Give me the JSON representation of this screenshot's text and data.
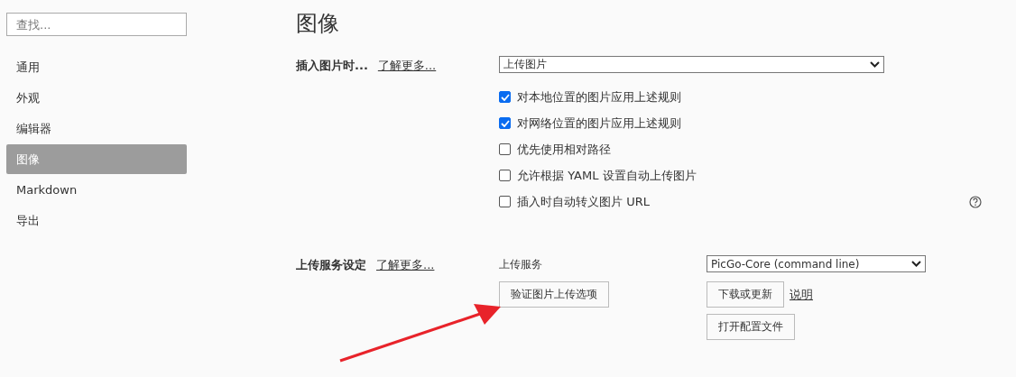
{
  "sidebar": {
    "search": {
      "placeholder": "查找..."
    },
    "items": [
      {
        "label": "通用",
        "selected": false
      },
      {
        "label": "外观",
        "selected": false
      },
      {
        "label": "编辑器",
        "selected": false
      },
      {
        "label": "图像",
        "selected": true
      },
      {
        "label": "Markdown",
        "selected": false
      },
      {
        "label": "导出",
        "selected": false
      }
    ]
  },
  "page_title": "图像",
  "insert_section": {
    "label": "插入图片时...",
    "link": "了解更多...",
    "select_value": "上传图片",
    "options": [
      {
        "label": "对本地位置的图片应用上述规则",
        "checked": true
      },
      {
        "label": "对网络位置的图片应用上述规则",
        "checked": true
      },
      {
        "label": "优先使用相对路径",
        "checked": false
      },
      {
        "label": "允许根据 YAML 设置自动上传图片",
        "checked": false
      },
      {
        "label": "插入时自动转义图片 URL",
        "checked": false
      }
    ]
  },
  "upload_section": {
    "label": "上传服务设定",
    "link": "了解更多...",
    "service_label": "上传服务",
    "service_value": "PicGo-Core (command line)",
    "verify_button": "验证图片上传选项",
    "download_button": "下载或更新",
    "help_link": "说明",
    "open_config_button": "打开配置文件"
  }
}
